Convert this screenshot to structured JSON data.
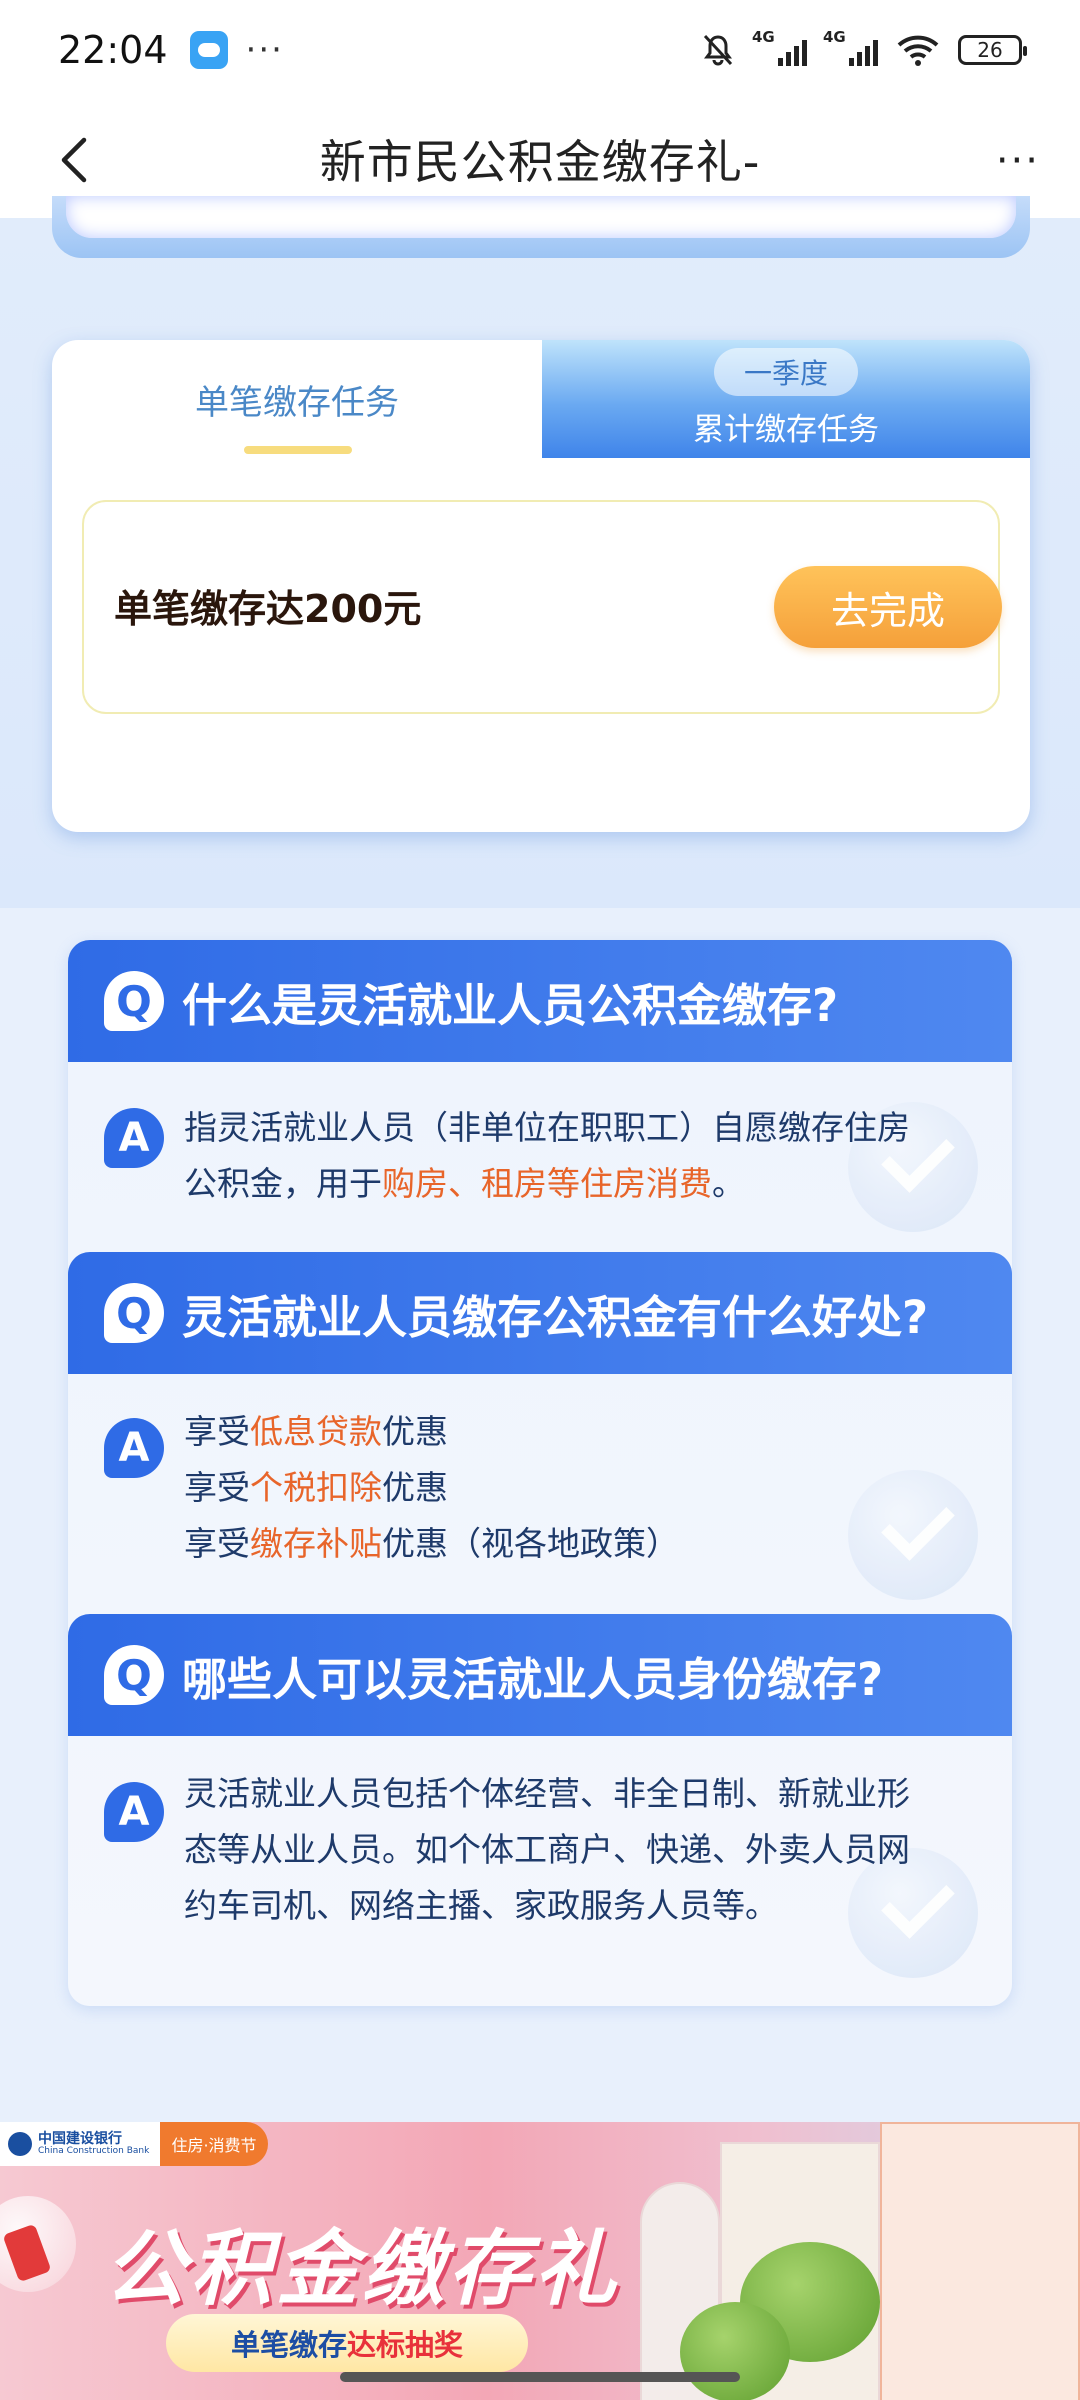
{
  "status_bar": {
    "time": "22:04",
    "more": "···",
    "signal_label_1": "4G",
    "signal_label_2": "4G",
    "battery": "26"
  },
  "nav": {
    "title": "新市民公积金缴存礼-",
    "more": "···"
  },
  "task_card": {
    "tab_single": "单笔缴存任务",
    "tab_cumulative_badge": "一季度",
    "tab_cumulative": "累计缴存任务",
    "task_text": "单笔缴存达200元",
    "task_button": "去完成"
  },
  "faq": [
    {
      "q_icon": "Q",
      "question": "什么是灵活就业人员公积金缴存?",
      "a_icon": "A",
      "answer_parts": {
        "line1": "指灵活就业人员（非单位在职职工）自愿缴存住房",
        "line2_a": "公积金，用于",
        "line2_hl": "购房、租房等住房消费",
        "line2_b": "。"
      }
    },
    {
      "q_icon": "Q",
      "question": "灵活就业人员缴存公积金有什么好处?",
      "a_icon": "A",
      "answer_parts": {
        "l1_a": "享受",
        "l1_hl": "低息贷款",
        "l1_b": "优惠",
        "l2_a": "享受",
        "l2_hl": "个税扣除",
        "l2_b": "优惠",
        "l3_a": "享受",
        "l3_hl": "缴存补贴",
        "l3_b": "优惠（视各地政策）"
      }
    },
    {
      "q_icon": "Q",
      "question": "哪些人可以灵活就业人员身份缴存?",
      "a_icon": "A",
      "answer_parts": {
        "line1": "灵活就业人员包括个体经营、非全日制、新就业形",
        "line2": "态等从业人员。如个体工商户、快递、外卖人员网",
        "line3": "约车司机、网络主播、家政服务人员等。"
      }
    }
  ],
  "banner": {
    "bank_name": "中国建设银行",
    "bank_name_en": "China Construction Bank",
    "event_tag": "住房·消费节",
    "title": "公积金缴存礼",
    "sub_a": "单笔缴存",
    "sub_b": "达标抽奖"
  },
  "colors": {
    "accent_blue": "#2f6be6",
    "highlight_orange": "#e8652a",
    "button_orange": "#f5a03a"
  }
}
